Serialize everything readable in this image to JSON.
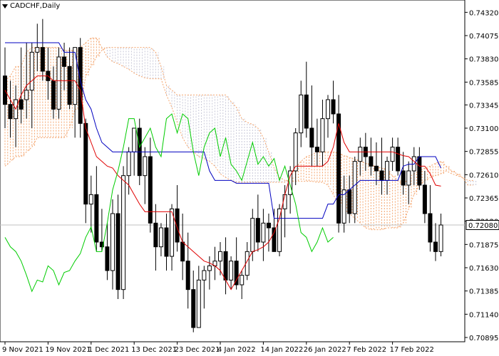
{
  "window": {
    "symbol_title": "CADCHF,Daily",
    "menu_icon": "triangle-down-icon"
  },
  "colors": {
    "tenkan": "#e00000",
    "kijun": "#0000c0",
    "chikou": "#00cc00",
    "cloud": "#f4a46c",
    "cloud_alt": "#c8c8d8",
    "price_line": "#c0c0c0",
    "price_label_bg": "#ffffff",
    "candle": "#000000"
  },
  "chart_data": {
    "type": "candlestick",
    "instrument": "CADCHF",
    "timeframe": "Daily",
    "ylim": [
      0.7085,
      0.7445
    ],
    "yticks": [
      "0.74320",
      "0.74075",
      "0.73830",
      "0.73585",
      "0.73345",
      "0.73100",
      "0.72855",
      "0.72610",
      "0.72365",
      "0.72120",
      "0.71875",
      "0.71630",
      "0.71385",
      "0.71140",
      "0.70895"
    ],
    "current_price": "0.72080",
    "xlabels": [
      "9 Nov 2021",
      "19 Nov 2021",
      "1 Dec 2021",
      "13 Dec 2021",
      "23 Dec 2021",
      "4 Jan 2022",
      "14 Jan 2022",
      "26 Jan 2022",
      "7 Feb 2022",
      "17 Feb 2022"
    ],
    "xlabel_index": [
      0,
      8,
      16,
      24,
      32,
      40,
      48,
      56,
      64,
      72
    ],
    "candles": [
      [
        0.7365,
        0.7395,
        0.731,
        0.7335
      ],
      [
        0.7335,
        0.736,
        0.73,
        0.732
      ],
      [
        0.732,
        0.7355,
        0.729,
        0.734
      ],
      [
        0.734,
        0.7395,
        0.7315,
        0.733
      ],
      [
        0.734,
        0.74,
        0.732,
        0.735
      ],
      [
        0.735,
        0.74,
        0.731,
        0.739
      ],
      [
        0.739,
        0.742,
        0.737,
        0.7395
      ],
      [
        0.7395,
        0.7425,
        0.736,
        0.737
      ],
      [
        0.737,
        0.7395,
        0.734,
        0.736
      ],
      [
        0.736,
        0.7375,
        0.732,
        0.733
      ],
      [
        0.733,
        0.7395,
        0.732,
        0.7385
      ],
      [
        0.7385,
        0.74,
        0.735,
        0.7375
      ],
      [
        0.7375,
        0.7395,
        0.733,
        0.7335
      ],
      [
        0.7335,
        0.736,
        0.73,
        0.7395
      ],
      [
        0.7395,
        0.7405,
        0.73,
        0.7315
      ],
      [
        0.7315,
        0.732,
        0.721,
        0.723
      ],
      [
        0.723,
        0.726,
        0.72,
        0.724
      ],
      [
        0.724,
        0.727,
        0.718,
        0.719
      ],
      [
        0.719,
        0.7225,
        0.718,
        0.7185
      ],
      [
        0.7185,
        0.721,
        0.715,
        0.716
      ],
      [
        0.716,
        0.7235,
        0.714,
        0.722
      ],
      [
        0.722,
        0.724,
        0.713,
        0.714
      ],
      [
        0.714,
        0.727,
        0.713,
        0.726
      ],
      [
        0.726,
        0.729,
        0.724,
        0.7285
      ],
      [
        0.7285,
        0.73,
        0.726,
        0.731
      ],
      [
        0.731,
        0.732,
        0.725,
        0.726
      ],
      [
        0.726,
        0.729,
        0.723,
        0.728
      ],
      [
        0.728,
        0.73,
        0.72,
        0.721
      ],
      [
        0.721,
        0.723,
        0.716,
        0.7185
      ],
      [
        0.7185,
        0.721,
        0.7175,
        0.7205
      ],
      [
        0.7205,
        0.722,
        0.716,
        0.7175
      ],
      [
        0.7175,
        0.723,
        0.716,
        0.7225
      ],
      [
        0.7225,
        0.725,
        0.718,
        0.719
      ],
      [
        0.719,
        0.722,
        0.715,
        0.717
      ],
      [
        0.717,
        0.72,
        0.712,
        0.714
      ],
      [
        0.714,
        0.716,
        0.7095,
        0.71
      ],
      [
        0.71,
        0.7165,
        0.71,
        0.715
      ],
      [
        0.715,
        0.7165,
        0.712,
        0.716
      ],
      [
        0.716,
        0.7175,
        0.714,
        0.7165
      ],
      [
        0.7165,
        0.7185,
        0.715,
        0.717
      ],
      [
        0.717,
        0.719,
        0.7155,
        0.718
      ],
      [
        0.718,
        0.7195,
        0.7135,
        0.715
      ],
      [
        0.715,
        0.7175,
        0.714,
        0.717
      ],
      [
        0.717,
        0.7195,
        0.714,
        0.7145
      ],
      [
        0.7145,
        0.716,
        0.713,
        0.7155
      ],
      [
        0.7155,
        0.719,
        0.715,
        0.718
      ],
      [
        0.718,
        0.7225,
        0.717,
        0.7215
      ],
      [
        0.7215,
        0.724,
        0.718,
        0.719
      ],
      [
        0.719,
        0.7225,
        0.717,
        0.721
      ],
      [
        0.721,
        0.722,
        0.718,
        0.7205
      ],
      [
        0.7205,
        0.7225,
        0.718,
        0.718
      ],
      [
        0.718,
        0.723,
        0.7175,
        0.7225
      ],
      [
        0.7225,
        0.725,
        0.7195,
        0.724
      ],
      [
        0.724,
        0.727,
        0.722,
        0.7265
      ],
      [
        0.7265,
        0.731,
        0.725,
        0.7305
      ],
      [
        0.7305,
        0.736,
        0.729,
        0.7345
      ],
      [
        0.7345,
        0.738,
        0.73,
        0.731
      ],
      [
        0.731,
        0.7355,
        0.727,
        0.729
      ],
      [
        0.729,
        0.732,
        0.727,
        0.7285
      ],
      [
        0.7285,
        0.734,
        0.727,
        0.732
      ],
      [
        0.732,
        0.7345,
        0.73,
        0.734
      ],
      [
        0.734,
        0.736,
        0.7315,
        0.7325
      ],
      [
        0.7325,
        0.7345,
        0.72,
        0.721
      ],
      [
        0.721,
        0.726,
        0.72,
        0.7245
      ],
      [
        0.7245,
        0.726,
        0.721,
        0.722
      ],
      [
        0.722,
        0.728,
        0.721,
        0.7275
      ],
      [
        0.7275,
        0.73,
        0.726,
        0.729
      ],
      [
        0.729,
        0.7305,
        0.7265,
        0.728
      ],
      [
        0.728,
        0.73,
        0.726,
        0.727
      ],
      [
        0.727,
        0.7295,
        0.725,
        0.7265
      ],
      [
        0.7265,
        0.73,
        0.724,
        0.7255
      ],
      [
        0.7255,
        0.728,
        0.724,
        0.7275
      ],
      [
        0.7275,
        0.73,
        0.7265,
        0.729
      ],
      [
        0.729,
        0.73,
        0.726,
        0.7265
      ],
      [
        0.7265,
        0.7285,
        0.724,
        0.725
      ],
      [
        0.725,
        0.7275,
        0.723,
        0.7265
      ],
      [
        0.7265,
        0.729,
        0.725,
        0.728
      ],
      [
        0.728,
        0.729,
        0.7245,
        0.725
      ],
      [
        0.725,
        0.7265,
        0.721,
        0.722
      ],
      [
        0.722,
        0.725,
        0.718,
        0.719
      ],
      [
        0.719,
        0.721,
        0.717,
        0.718
      ],
      [
        0.718,
        0.722,
        0.7175,
        0.7208
      ]
    ],
    "tenkan": [
      0.735,
      0.734,
      0.733,
      0.7345,
      0.7355,
      0.736,
      0.7365,
      0.7365,
      0.7365,
      0.736,
      0.736,
      0.736,
      0.736,
      0.736,
      0.735,
      0.731,
      0.7295,
      0.728,
      0.7275,
      0.727,
      0.7268,
      0.726,
      0.7255,
      0.725,
      0.724,
      0.723,
      0.7222,
      0.7222,
      0.7222,
      0.7222,
      0.7222,
      0.7222,
      0.7205,
      0.719,
      0.7185,
      0.718,
      0.7175,
      0.717,
      0.7168,
      0.7165,
      0.716,
      0.715,
      0.714,
      0.715,
      0.716,
      0.717,
      0.718,
      0.7182,
      0.7185,
      0.719,
      0.72,
      0.7215,
      0.724,
      0.726,
      0.727,
      0.727,
      0.727,
      0.727,
      0.727,
      0.727,
      0.7275,
      0.729,
      0.7315,
      0.7295,
      0.7285,
      0.7285,
      0.7285,
      0.7285,
      0.7285,
      0.7285,
      0.7285,
      0.7285,
      0.7285,
      0.7283,
      0.7281,
      0.728,
      0.7275,
      0.727,
      0.727,
      0.7262,
      0.725,
      0.7249
    ],
    "kijun": [
      0.74,
      0.74,
      0.74,
      0.74,
      0.74,
      0.74,
      0.74,
      0.74,
      0.74,
      0.74,
      0.74,
      0.739,
      0.739,
      0.739,
      0.736,
      0.734,
      0.733,
      0.731,
      0.7295,
      0.729,
      0.7285,
      0.7285,
      0.7285,
      0.7285,
      0.7285,
      0.7285,
      0.7285,
      0.7285,
      0.7285,
      0.7285,
      0.7285,
      0.7285,
      0.7285,
      0.7285,
      0.7285,
      0.7285,
      0.7285,
      0.7285,
      0.7265,
      0.7255,
      0.7255,
      0.7255,
      0.7255,
      0.7252,
      0.7252,
      0.7252,
      0.7252,
      0.7252,
      0.7252,
      0.7252,
      0.7215,
      0.7215,
      0.7215,
      0.7215,
      0.7215,
      0.7215,
      0.7215,
      0.7215,
      0.7215,
      0.7215,
      0.723,
      0.723,
      0.724,
      0.724,
      0.7245,
      0.725,
      0.7255,
      0.7255,
      0.7255,
      0.7255,
      0.7255,
      0.7255,
      0.7255,
      0.7255,
      0.727,
      0.7272,
      0.7272,
      0.728,
      0.728,
      0.728,
      0.728,
      0.7268
    ],
    "chikou": [
      0.7195,
      0.7185,
      0.718,
      0.717,
      0.7155,
      0.7138,
      0.715,
      0.7148,
      0.7165,
      0.716,
      0.7145,
      0.7158,
      0.716,
      0.717,
      0.7178,
      0.7195,
      0.7206,
      0.718,
      0.718,
      0.721,
      0.7245,
      0.7265,
      0.729,
      0.732,
      0.732,
      0.729,
      0.73,
      0.731,
      0.729,
      0.728,
      0.732,
      0.7325,
      0.7305,
      0.7325,
      0.732,
      0.7285,
      0.726,
      0.729,
      0.7305,
      0.731,
      0.728,
      0.73,
      0.7272,
      0.7265,
      0.7255,
      0.7275,
      0.7295,
      0.7272,
      0.728,
      0.727,
      0.7278,
      0.7255,
      0.727,
      0.725,
      0.723,
      0.72,
      0.7195,
      0.718,
      0.719,
      0.7205,
      0.719,
      0.7195
    ],
    "chikou_start_index": 0,
    "span_a": [
      0.736,
      0.7365,
      0.7375,
      0.7375,
      0.739,
      0.7395,
      0.7395,
      0.7395,
      0.7395,
      0.7395,
      0.7395,
      0.7392,
      0.7392,
      0.7392,
      0.7395,
      0.74,
      0.7405,
      0.7405,
      0.7395,
      0.7385,
      0.738,
      0.7378,
      0.7375,
      0.7372,
      0.7368,
      0.7365,
      0.7363,
      0.7362,
      0.7362,
      0.7362,
      0.7345,
      0.7332,
      0.7316,
      0.73,
      0.729,
      0.7285,
      0.728,
      0.7278,
      0.7275,
      0.727,
      0.7262,
      0.7258,
      0.7255,
      0.7253,
      0.7253,
      0.7253,
      0.7253,
      0.7253,
      0.7253,
      0.7253,
      0.7253,
      0.7253,
      0.7253,
      0.7258,
      0.7268,
      0.7275,
      0.728,
      0.7282,
      0.7285,
      0.7285,
      0.7285,
      0.7285,
      0.7283,
      0.7281,
      0.7279,
      0.7277,
      0.7275,
      0.7273,
      0.7271,
      0.7269,
      0.7268,
      0.7265,
      0.726,
      0.7255,
      0.725,
      0.7258,
      0.7262,
      0.7265,
      0.7268,
      0.727,
      0.7273,
      0.7275,
      0.727,
      0.7265,
      0.7262,
      0.7258,
      0.725,
      0.725
    ],
    "span_b": [
      0.727,
      0.7275,
      0.728,
      0.728,
      0.7285,
      0.729,
      0.73,
      0.73,
      0.73,
      0.73,
      0.73,
      0.73,
      0.731,
      0.733,
      0.733,
      0.7365,
      0.7375,
      0.7385,
      0.7392,
      0.7395,
      0.7395,
      0.7395,
      0.7395,
      0.7395,
      0.7395,
      0.7395,
      0.7395,
      0.7395,
      0.739,
      0.7375,
      0.7355,
      0.735,
      0.7345,
      0.7345,
      0.7345,
      0.7345,
      0.7345,
      0.7345,
      0.7345,
      0.7345,
      0.7345,
      0.7345,
      0.7338,
      0.7332,
      0.732,
      0.7316,
      0.7314,
      0.731,
      0.73,
      0.7285,
      0.7268,
      0.7258,
      0.7255,
      0.7254,
      0.7254,
      0.7254,
      0.7254,
      0.7254,
      0.7253,
      0.7253,
      0.725,
      0.724,
      0.723,
      0.7225,
      0.722,
      0.7215,
      0.721,
      0.7205,
      0.7203,
      0.7203,
      0.7203,
      0.7205,
      0.7205,
      0.7205,
      0.721,
      0.7225,
      0.724,
      0.725,
      0.7255,
      0.7258,
      0.726,
      0.7262,
      0.7265,
      0.7262,
      0.726,
      0.7258,
      0.7255,
      0.7255
    ]
  }
}
